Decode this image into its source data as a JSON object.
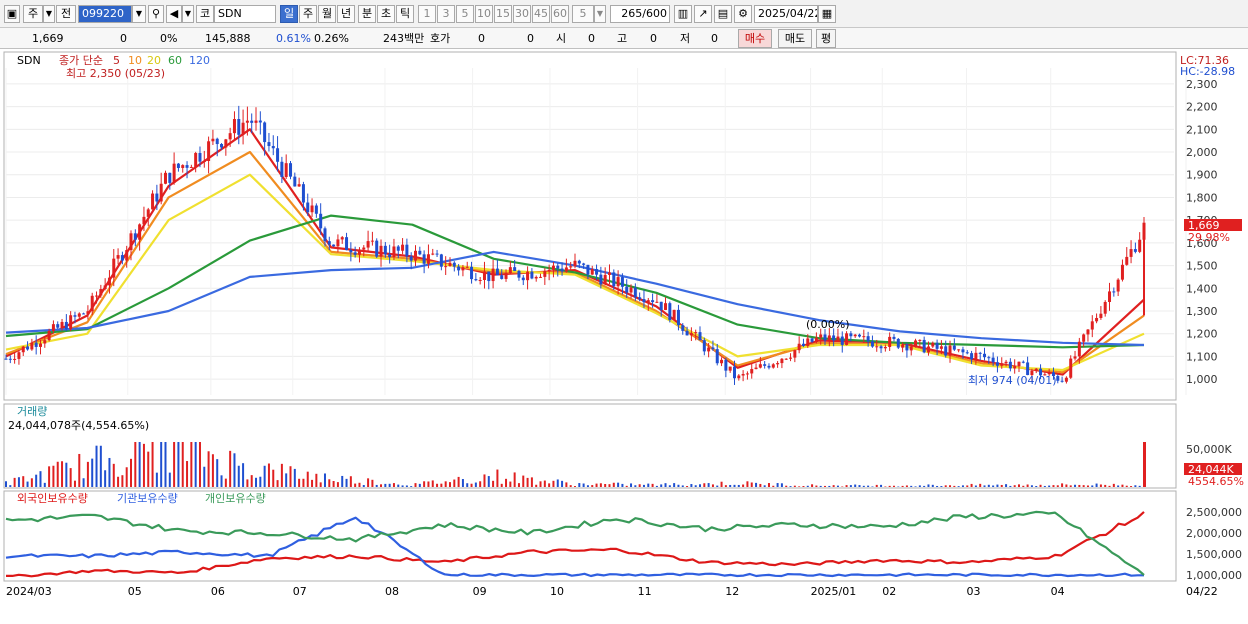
{
  "toolbar": {
    "period_label": "주",
    "prev_label": "전",
    "code": "099220",
    "market_label": "코",
    "name": "SDN",
    "timeframes": [
      "일",
      "주",
      "월",
      "년",
      "분",
      "초",
      "틱"
    ],
    "active_timeframe": "일",
    "intervals": [
      "1",
      "3",
      "5",
      "10",
      "15",
      "30",
      "45",
      "60"
    ],
    "interval_select": "5",
    "count_display": "265",
    "count_total": "/600",
    "date": "2025/04/22"
  },
  "quote": {
    "price": "1,669",
    "change": "0",
    "change_pct": "0%",
    "volume": "145,888",
    "vol_ratio": "0.61%",
    "turnover_ratio": "0.26%",
    "amount": "243백만",
    "ask_label": "호가",
    "ask_value": "0",
    "ask_value2": "0",
    "open_label": "시",
    "open_value": "0",
    "high_label": "고",
    "high_value": "0",
    "low_label": "저",
    "low_value": "0",
    "buy_label": "매수",
    "sell_label": "매도",
    "avg_label": "평"
  },
  "price_panel": {
    "stock_label": "SDN",
    "ma_label": "종가 단순",
    "ma_periods": [
      "5",
      "10",
      "20",
      "60",
      "120"
    ],
    "high_note": "최고 2,350 (05/23)",
    "low_note": "최저 974 (04/01)",
    "mid_note": "(0.00%)",
    "lc": "LC:71.36",
    "hc": "HC:-28.98",
    "last_price_tag": "1,669",
    "last_pct_tag": "29.98%"
  },
  "volume_panel": {
    "title": "거래량",
    "last": "24,044,078주(4,554.65%)",
    "tag_value": "24,044K",
    "tag_pct": "4554.65%"
  },
  "holding_panel": {
    "legend": [
      "외국인보유수량",
      "기관보유수량",
      "개인보유수량"
    ]
  },
  "x_axis": {
    "labels": [
      "2024/03",
      "05",
      "06",
      "07",
      "08",
      "09",
      "10",
      "11",
      "12",
      "2025/01",
      "02",
      "03",
      "04",
      "04/22"
    ]
  },
  "colors": {
    "up": "#e02020",
    "down": "#1f4fd0",
    "ma5": "#e02020",
    "ma10": "#f08c20",
    "ma20": "#f0e030",
    "ma60": "#2a9a3a",
    "ma120": "#3a6ae0",
    "foreign": "#dd1818",
    "institution": "#2f5fe0",
    "individual": "#3a9a5a"
  },
  "chart_data": [
    {
      "type": "line",
      "title": "SDN",
      "x": [
        "2024/03",
        "04",
        "05",
        "06",
        "07",
        "08",
        "09",
        "10",
        "11",
        "12",
        "2025/01",
        "02",
        "03",
        "04",
        "04/22"
      ],
      "series": [
        {
          "name": "종가",
          "values": [
            1090,
            1300,
            1900,
            2150,
            1600,
            1550,
            1450,
            1500,
            1350,
            1000,
            1180,
            1160,
            1100,
            1000,
            1669
          ]
        },
        {
          "name": "5",
          "values": [
            1100,
            1280,
            1850,
            2100,
            1580,
            1540,
            1460,
            1480,
            1320,
            1050,
            1170,
            1160,
            1080,
            1020,
            1350
          ]
        },
        {
          "name": "10",
          "values": [
            1110,
            1250,
            1800,
            2000,
            1560,
            1530,
            1470,
            1470,
            1300,
            1060,
            1160,
            1150,
            1070,
            1030,
            1280
          ]
        },
        {
          "name": "20",
          "values": [
            1130,
            1200,
            1700,
            1900,
            1550,
            1520,
            1480,
            1460,
            1290,
            1100,
            1150,
            1150,
            1060,
            1040,
            1200
          ]
        },
        {
          "name": "60",
          "values": [
            1190,
            1220,
            1400,
            1610,
            1720,
            1680,
            1530,
            1470,
            1380,
            1240,
            1180,
            1160,
            1150,
            1140,
            1150
          ]
        },
        {
          "name": "120",
          "values": [
            1205,
            1225,
            1300,
            1450,
            1480,
            1490,
            1560,
            1500,
            1420,
            1330,
            1260,
            1210,
            1180,
            1160,
            1150
          ]
        }
      ],
      "ylim": [
        930,
        2370
      ],
      "yticks": [
        1000,
        1100,
        1200,
        1300,
        1400,
        1500,
        1600,
        1700,
        1800,
        1900,
        2000,
        2100,
        2200,
        2300
      ],
      "annotations": {
        "max": {
          "value": 2350,
          "date": "05/23"
        },
        "min": {
          "value": 974,
          "date": "04/01"
        },
        "last": 1669
      }
    },
    {
      "type": "bar",
      "title": "거래량",
      "x": [
        "2024/03",
        "04",
        "05",
        "06",
        "07",
        "08",
        "09",
        "10",
        "11",
        "12",
        "2025/01",
        "02",
        "03",
        "04",
        "04/22"
      ],
      "values": [
        5000,
        30000,
        60000,
        25000,
        12000,
        3000,
        15000,
        4000,
        3000,
        5000,
        2000,
        2000,
        2500,
        3000,
        24044078
      ],
      "yticks": [
        50000
      ]
    },
    {
      "type": "line",
      "title": "보유수량",
      "x": [
        "2024/03",
        "05",
        "06",
        "07",
        "08",
        "09",
        "10",
        "11",
        "12",
        "2025/01",
        "02",
        "03",
        "04",
        "04/22"
      ],
      "series": [
        {
          "name": "외국인보유수량",
          "values": [
            950000,
            1100000,
            1050000,
            1400000,
            1450000,
            1300000,
            1550000,
            1600000,
            1300000,
            1250000,
            1350000,
            1300000,
            1450000,
            2450000
          ]
        },
        {
          "name": "기관보유수량",
          "values": [
            1450000,
            1450000,
            1550000,
            1450000,
            2400000,
            1000000,
            1000000,
            1000000,
            1000000,
            1000000,
            1000000,
            1000000,
            1000000,
            1000000
          ]
        },
        {
          "name": "개인보유수량",
          "values": [
            2300000,
            2400000,
            2050000,
            2000000,
            1850000,
            2200000,
            2000000,
            2350000,
            2100000,
            2200000,
            2150000,
            2400000,
            2450000,
            1000000
          ]
        }
      ],
      "yticks": [
        1000000,
        1500000,
        2000000,
        2500000
      ]
    }
  ]
}
